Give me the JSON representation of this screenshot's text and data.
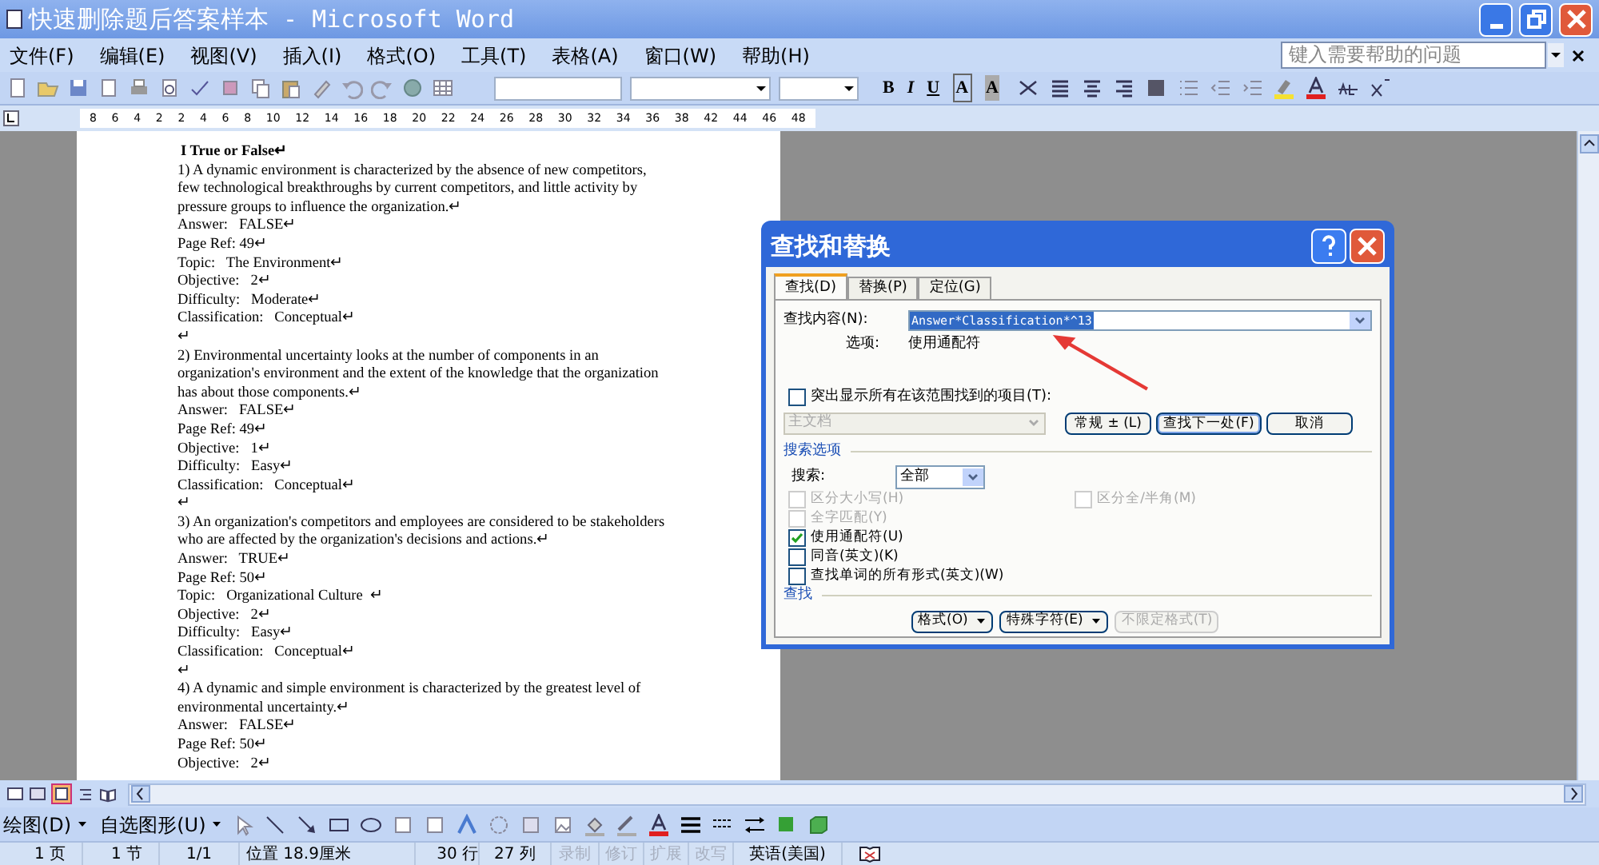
{
  "window": {
    "title": "快速删除题后答案样本 - Microsoft Word"
  },
  "menu": [
    "文件(F)",
    "编辑(E)",
    "视图(V)",
    "插入(I)",
    "格式(O)",
    "工具(T)",
    "表格(A)",
    "窗口(W)",
    "帮助(H)"
  ],
  "help_box": {
    "placeholder": "键入需要帮助的问题"
  },
  "format_buttons": [
    "B",
    "I",
    "U",
    "A",
    "A"
  ],
  "ruler_labels": [
    "8",
    "6",
    "4",
    "2",
    "2",
    "4",
    "6",
    "8",
    "10",
    "12",
    "14",
    "16",
    "18",
    "20",
    "22",
    "24",
    "26",
    "28",
    "30",
    "32",
    "34",
    "36",
    "38",
    "42",
    "44",
    "46",
    "48"
  ],
  "document": [
    {
      "kind": "heading",
      "text": "I True or False↵"
    },
    {
      "kind": "paragraph",
      "text": "1) A dynamic environment is characterized by the absence of new competitors, few technological breakthroughs by current competitors, and little activity by pressure groups to influence the organization.↵"
    },
    {
      "kind": "paragraph",
      "text": "Answer:   FALSE↵"
    },
    {
      "kind": "paragraph",
      "text": "Page Ref: 49↵"
    },
    {
      "kind": "paragraph",
      "text": "Topic:   The Environment↵"
    },
    {
      "kind": "paragraph",
      "text": "Objective:   2↵"
    },
    {
      "kind": "paragraph",
      "text": "Difficulty:   Moderate↵"
    },
    {
      "kind": "paragraph",
      "text": "Classification:   Conceptual↵"
    },
    {
      "kind": "paragraph",
      "text": "↵"
    },
    {
      "kind": "paragraph",
      "text": "2) Environmental uncertainty looks at the number of components in an organization's environment and the extent of the knowledge that the organization has about those components.↵"
    },
    {
      "kind": "paragraph",
      "text": "Answer:   FALSE↵"
    },
    {
      "kind": "paragraph",
      "text": "Page Ref: 49↵"
    },
    {
      "kind": "paragraph",
      "text": "Objective:   1↵"
    },
    {
      "kind": "paragraph",
      "text": "Difficulty:   Easy↵"
    },
    {
      "kind": "paragraph",
      "text": "Classification:   Conceptual↵"
    },
    {
      "kind": "paragraph",
      "text": "↵"
    },
    {
      "kind": "paragraph",
      "text": "3) An organization's competitors and employees are considered to be stakeholders who are affected by the organization's decisions and actions.↵"
    },
    {
      "kind": "paragraph",
      "text": "Answer:   TRUE↵"
    },
    {
      "kind": "paragraph",
      "text": "Page Ref: 50↵"
    },
    {
      "kind": "paragraph",
      "text": "Topic:   Organizational Culture  ↵"
    },
    {
      "kind": "paragraph",
      "text": "Objective:   2↵"
    },
    {
      "kind": "paragraph",
      "text": "Difficulty:   Easy↵"
    },
    {
      "kind": "paragraph",
      "text": "Classification:   Conceptual↵"
    },
    {
      "kind": "paragraph",
      "text": "↵"
    },
    {
      "kind": "paragraph",
      "text": "4) A dynamic and simple environment is characterized by the greatest level of environmental uncertainty.↵"
    },
    {
      "kind": "paragraph",
      "text": "Answer:   FALSE↵"
    },
    {
      "kind": "paragraph",
      "text": "Page Ref: 50↵"
    },
    {
      "kind": "paragraph",
      "text": "Objective:   2↵"
    }
  ],
  "dialog": {
    "title": "查找和替换",
    "tabs": [
      {
        "label": "查找(D)",
        "selected": true
      },
      {
        "label": "替换(P)",
        "selected": false
      },
      {
        "label": "定位(G)",
        "selected": false
      }
    ],
    "find_label": "查找内容(N):",
    "find_value": "Answer*Classification*^13",
    "options_label": "选项:",
    "options_value": "使用通配符",
    "highlight": {
      "label": "突出显示所有在该范围找到的项目(T):",
      "checked": false
    },
    "scope": {
      "value": "主文档",
      "disabled": true
    },
    "buttons": [
      {
        "label": "常规 ± (L)",
        "default": false
      },
      {
        "label": "查找下一处(F)",
        "default": true
      },
      {
        "label": "取消",
        "default": false
      }
    ],
    "search_options_heading": "搜索选项",
    "search_label": "搜索:",
    "search_value": "全部",
    "options": [
      {
        "label": "区分大小写(H)",
        "checked": false,
        "disabled": true
      },
      {
        "label": "区分全/半角(M)",
        "checked": false,
        "disabled": true
      },
      {
        "label": "全字匹配(Y)",
        "checked": false,
        "disabled": true
      },
      {
        "label": "使用通配符(U)",
        "checked": true,
        "disabled": false
      },
      {
        "label": "同音(英文)(K)",
        "checked": false,
        "disabled": false
      },
      {
        "label": "查找单词的所有形式(英文)(W)",
        "checked": false,
        "disabled": false
      }
    ],
    "find_heading": "查找",
    "bottom_buttons": [
      {
        "label": "格式(O)",
        "dropdown": true,
        "disabled": false
      },
      {
        "label": "特殊字符(E)",
        "dropdown": true,
        "disabled": false
      },
      {
        "label": "不限定格式(T)",
        "dropdown": false,
        "disabled": true
      }
    ]
  },
  "drawing_toolbar": [
    "绘图(D)",
    "自选图形(U)"
  ],
  "status_bar": [
    {
      "text": "1 页",
      "disabled": false
    },
    {
      "text": "1 节",
      "disabled": false
    },
    {
      "text": "1/1",
      "disabled": false
    },
    {
      "text": "位置 18.9厘米",
      "disabled": false
    },
    {
      "text": "30 行",
      "disabled": false
    },
    {
      "text": "27 列",
      "disabled": false
    },
    {
      "text": "录制",
      "disabled": true
    },
    {
      "text": "修订",
      "disabled": true
    },
    {
      "text": "扩展",
      "disabled": true
    },
    {
      "text": "改写",
      "disabled": true
    },
    {
      "text": "英语(美国)",
      "disabled": false
    }
  ]
}
